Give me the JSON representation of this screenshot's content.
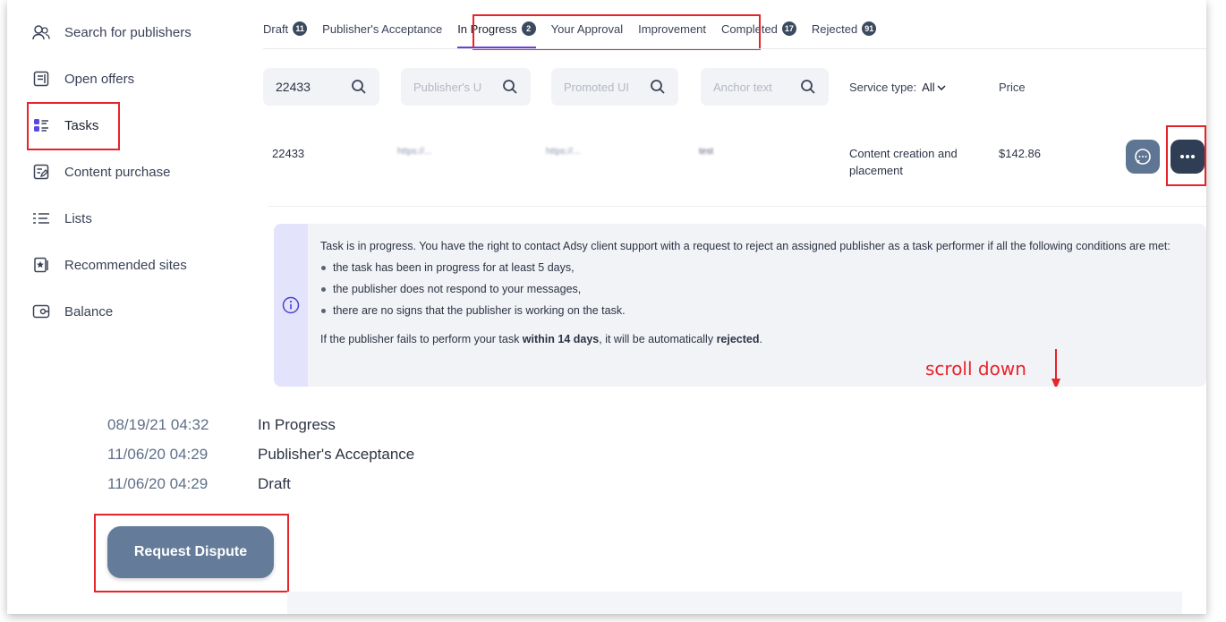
{
  "sidebar": {
    "items": [
      {
        "label": "Search for publishers",
        "icon": "users-icon"
      },
      {
        "label": "Open offers",
        "icon": "document-icon"
      },
      {
        "label": "Tasks",
        "icon": "tasks-icon",
        "active": true
      },
      {
        "label": "Content purchase",
        "icon": "edit-document-icon"
      },
      {
        "label": "Lists",
        "icon": "list-icon"
      },
      {
        "label": "Recommended sites",
        "icon": "star-document-icon"
      },
      {
        "label": "Balance",
        "icon": "wallet-icon"
      }
    ]
  },
  "tabs": [
    {
      "label": "Draft",
      "count": "11"
    },
    {
      "label": "Publisher's Acceptance",
      "count": ""
    },
    {
      "label": "In Progress",
      "count": "2",
      "active": true
    },
    {
      "label": "Your Approval",
      "count": ""
    },
    {
      "label": "Improvement",
      "count": ""
    },
    {
      "label": "Completed",
      "count": "17"
    },
    {
      "label": "Rejected",
      "count": "91"
    }
  ],
  "filters": {
    "id_value": "22433",
    "publisher_placeholder": "Publisher's U",
    "promoted_placeholder": "Promoted UI",
    "anchor_placeholder": "Anchor text",
    "service_label": "Service type:",
    "service_value": "All",
    "price_label": "Price"
  },
  "task_row": {
    "id": "22433",
    "publisher_url": "https://...",
    "promoted_url": "https://...",
    "anchor": "test",
    "service": "Content creation and placement",
    "price": "$142.86"
  },
  "info": {
    "intro": "Task is in progress. You have the right to contact Adsy client support with a request to reject an assigned publisher as a task performer if all the following conditions are met:",
    "conditions": [
      "the task has been in progress for at least 5 days,",
      "the publisher does not respond to your messages,",
      "there are no signs that the publisher is working on the task."
    ],
    "footer_pre": "If the publisher fails to perform your task ",
    "footer_bold1": "within 14 days",
    "footer_mid": ", it will be automatically ",
    "footer_bold2": "rejected",
    "footer_end": "."
  },
  "annotation": {
    "text": "scroll down",
    "color": "#e8232b"
  },
  "history": [
    {
      "date": "08/19/21 04:32",
      "status": "In Progress"
    },
    {
      "date": "11/06/20 04:29",
      "status": "Publisher's Acceptance"
    },
    {
      "date": "11/06/20 04:29",
      "status": "Draft"
    }
  ],
  "dispute_button": "Request Dispute",
  "colors": {
    "accent": "#6b3fd8",
    "highlight": "#e8232b",
    "button": "#647c99",
    "badge": "#3c4a5f"
  }
}
